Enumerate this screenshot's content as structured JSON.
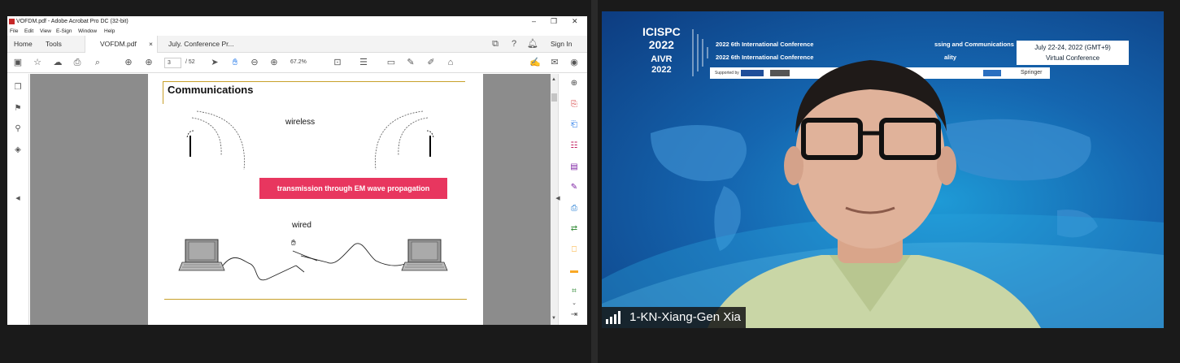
{
  "acrobat": {
    "window_title": "VOFDM.pdf - Adobe Acrobat Pro DC (32-bit)",
    "menu": [
      "File",
      "Edit",
      "View",
      "E-Sign",
      "Window",
      "Help"
    ],
    "tabs": {
      "home": "Home",
      "tools": "Tools",
      "doc1": "VOFDM.pdf",
      "doc1_close": "×",
      "doc2": "July. Conference Pr..."
    },
    "sign_in": "Sign In",
    "page_current": "3",
    "page_total": "/ 52",
    "zoom": "67.2%"
  },
  "slide": {
    "title": "Communications",
    "wireless_label": "wireless",
    "banner": "transmission through EM wave propagation",
    "wired_label": "wired"
  },
  "video": {
    "conf_logo": [
      "ICISPC",
      "2022",
      "AIVR",
      "2022"
    ],
    "conf_line1": "2022 6th International Conference",
    "conf_line1b": "ssing and Communications",
    "conf_line2": "2022 6th International Conference",
    "conf_line2b": "ality",
    "date_line1": "July 22-24, 2022 (GMT+9)",
    "date_line2": "Virtual Conference",
    "sponsor_label": "Supported by",
    "publisher": "Springer",
    "participant_name": "1-KN-Xiang-Gen Xia"
  },
  "colors": {
    "accent_pink": "#e8365f",
    "slide_rule": "#c8a02a",
    "video_bg": "#1566b0"
  }
}
